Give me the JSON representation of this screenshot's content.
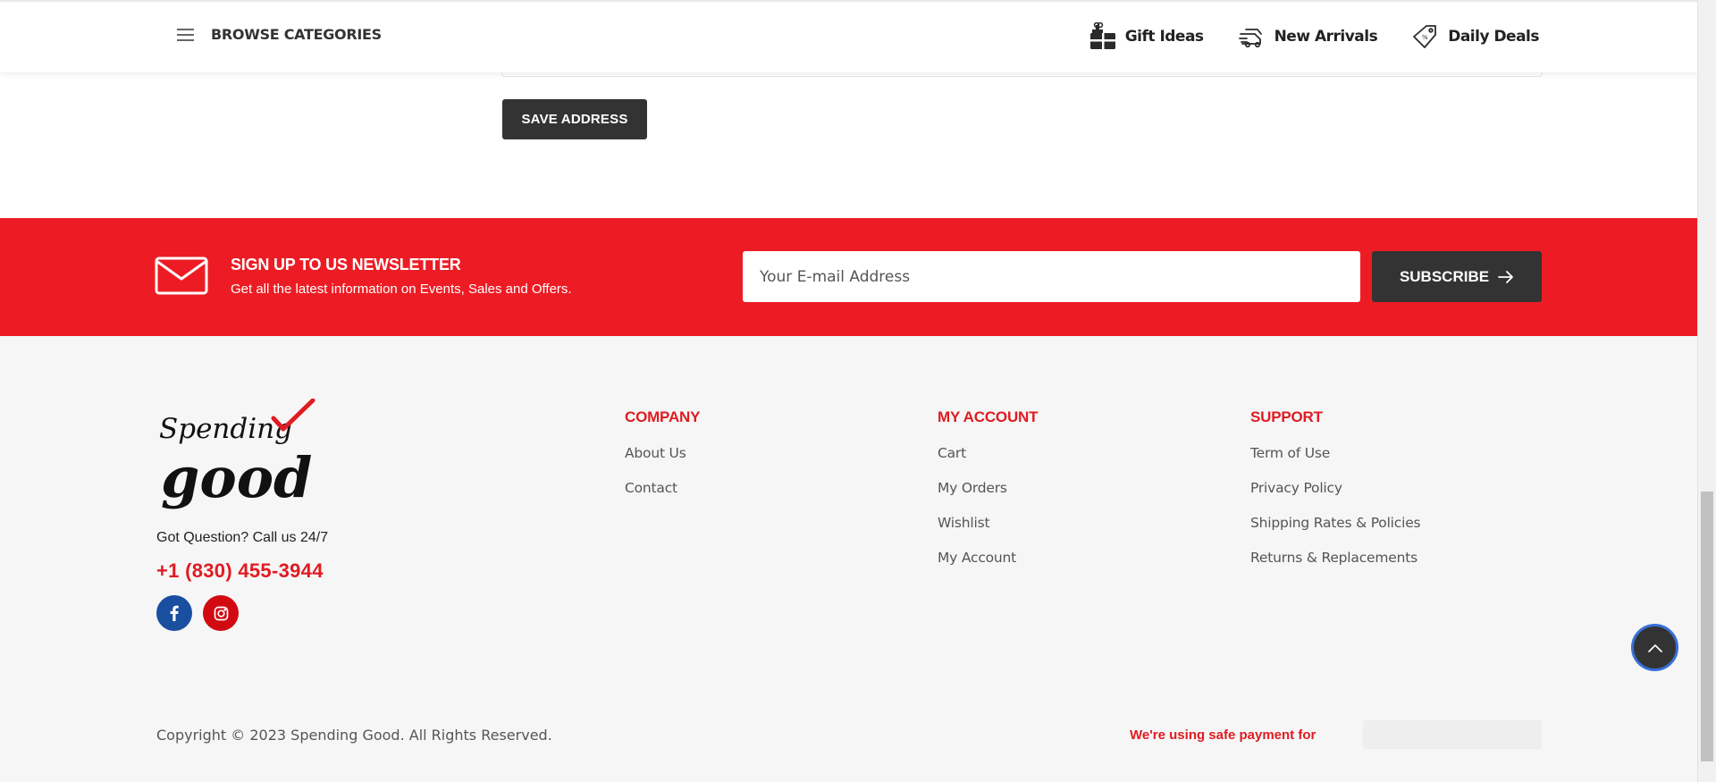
{
  "header": {
    "browse_label": "BROWSE CATEGORIES",
    "nav": [
      {
        "label": "Gift Ideas",
        "icon": "gift-icon"
      },
      {
        "label": "New Arrivals",
        "icon": "shipping-icon"
      },
      {
        "label": "Daily Deals",
        "icon": "price-tag-icon"
      }
    ]
  },
  "address_form": {
    "save_label": "SAVE ADDRESS"
  },
  "newsletter": {
    "title": "SIGN UP TO US NEWSLETTER",
    "subtitle": "Get all the latest information on Events, Sales and Offers.",
    "email_placeholder": "Your E-mail Address",
    "subscribe_label": "SUBSCRIBE",
    "icon": "envelope-icon"
  },
  "footer": {
    "logo_text_top": "Spending",
    "logo_text_bottom": "good",
    "question": "Got Question? Call us 24/7",
    "phone": "+1 (830) 455-3944",
    "social": [
      "facebook-icon",
      "instagram-icon"
    ],
    "columns": [
      {
        "title": "COMPANY",
        "links": [
          "About Us",
          "Contact"
        ]
      },
      {
        "title": "MY ACCOUNT",
        "links": [
          "Cart",
          "My Orders",
          "Wishlist",
          "My Account"
        ]
      },
      {
        "title": "SUPPORT",
        "links": [
          "Term of Use",
          "Privacy Policy",
          "Shipping Rates & Policies",
          "Returns & Replacements"
        ]
      }
    ],
    "copyright": "Copyright © 2023 Spending Good. All Rights Reserved.",
    "payment_text": "We're using safe payment for"
  },
  "colors": {
    "brand_red": "#ed1c24",
    "dark_button": "#333333",
    "footer_bg": "#f6f6f6"
  }
}
